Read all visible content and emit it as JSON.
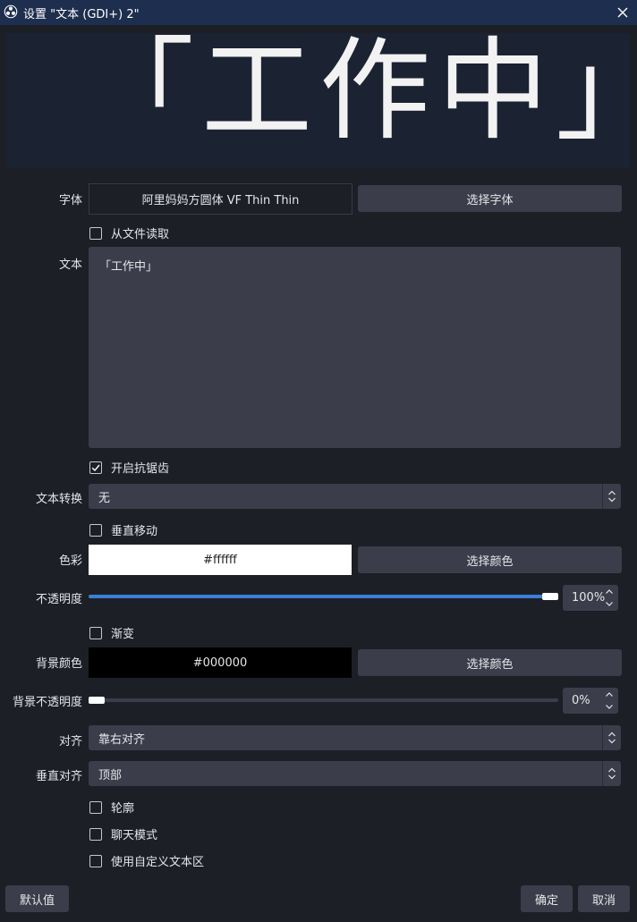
{
  "window": {
    "title": "设置 \"文本 (GDI+) 2\""
  },
  "preview": {
    "text": "「工作中」"
  },
  "font": {
    "label": "字体",
    "value": "阿里妈妈方圆体 VF Thin Thin",
    "button": "选择字体"
  },
  "read_from_file": {
    "label": "从文件读取",
    "checked": false
  },
  "text": {
    "label": "文本",
    "value": "「工作中」"
  },
  "antialias": {
    "label": "开启抗锯齿",
    "checked": true
  },
  "transform": {
    "label": "文本转换",
    "value": "无"
  },
  "vertical": {
    "label": "垂直移动",
    "checked": false
  },
  "color": {
    "label": "色彩",
    "value": "#ffffff",
    "button": "选择颜色"
  },
  "opacity": {
    "label": "不透明度",
    "value": "100%",
    "level": 1.0
  },
  "gradient": {
    "label": "渐变",
    "checked": false
  },
  "bg_color": {
    "label": "背景颜色",
    "value": "#000000",
    "button": "选择颜色"
  },
  "bg_opacity": {
    "label": "背景不透明度",
    "value": "0%",
    "level": 0.0
  },
  "align": {
    "label": "对齐",
    "value": "靠右对齐"
  },
  "valign": {
    "label": "垂直对齐",
    "value": "顶部"
  },
  "outline": {
    "label": "轮廓",
    "checked": false
  },
  "chat_mode": {
    "label": "聊天模式",
    "checked": false
  },
  "custom_area": {
    "label": "使用自定义文本区",
    "checked": false
  },
  "footer": {
    "defaults": "默认值",
    "ok": "确定",
    "cancel": "取消"
  },
  "colors": {
    "accent": "#3a7fd6",
    "button_bg": "#3b3e4a",
    "panel_bg": "#1d1f26",
    "titlebar_bg": "#1e2e4e"
  }
}
